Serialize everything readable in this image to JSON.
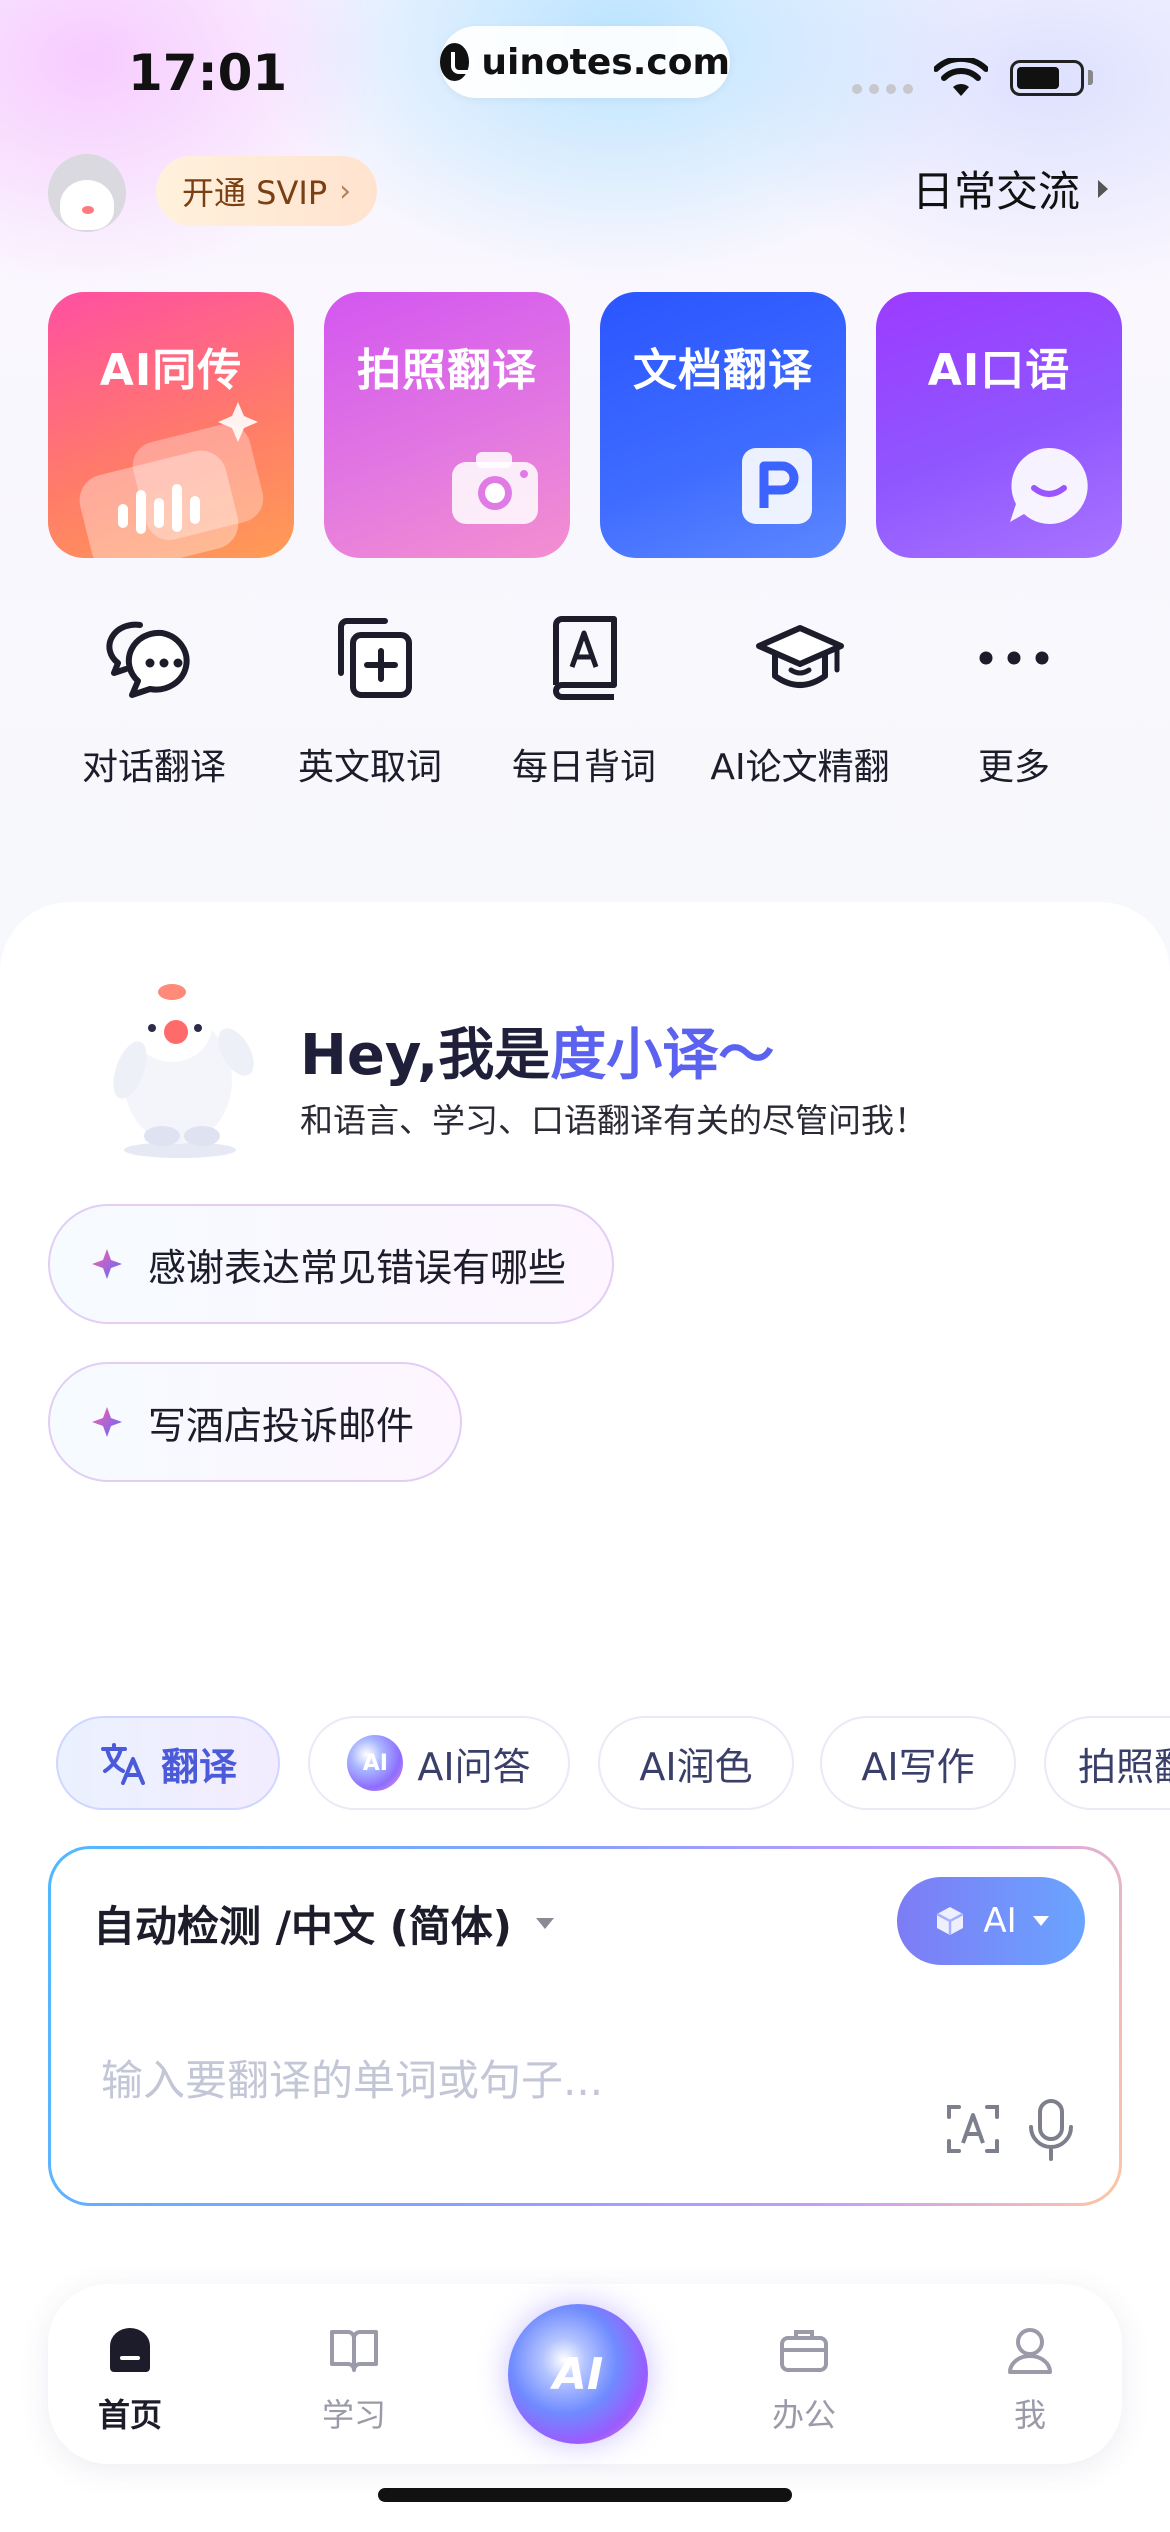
{
  "status_bar": {
    "time": "17:01",
    "url": "uinotes.com"
  },
  "header": {
    "svip_label": "开通 SVIP",
    "mode_label": "日常交流"
  },
  "feature_cards": [
    {
      "label": "AI同传"
    },
    {
      "label": "拍照翻译"
    },
    {
      "label": "文档翻译"
    },
    {
      "label": "AI口语"
    }
  ],
  "tools": [
    {
      "label": "对话翻译"
    },
    {
      "label": "英文取词"
    },
    {
      "label": "每日背词"
    },
    {
      "label": "AI论文精翻"
    },
    {
      "label": "更多"
    }
  ],
  "assistant": {
    "greeting_prefix": "Hey,我是",
    "greeting_name": "度小译",
    "greeting_suffix": "～",
    "subtitle": "和语言、学习、口语翻译有关的尽管问我！"
  },
  "suggestions": [
    "感谢表达常见错误有哪些",
    "写酒店投诉邮件"
  ],
  "mode_tabs": [
    {
      "label": "翻译",
      "active": true
    },
    {
      "label": "AI问答",
      "active": false
    },
    {
      "label": "AI润色",
      "active": false
    },
    {
      "label": "AI写作",
      "active": false
    },
    {
      "label": "拍照翻",
      "active": false
    }
  ],
  "input": {
    "language_label": "自动检测 /中文 (简体)",
    "ai_pill_label": "AI",
    "placeholder": "输入要翻译的单词或句子..."
  },
  "bottom_nav": {
    "items": [
      {
        "label": "首页",
        "active": true
      },
      {
        "label": "学习",
        "active": false
      },
      {
        "label": "办公",
        "active": false
      },
      {
        "label": "我",
        "active": false
      }
    ],
    "ai_label": "AI"
  }
}
